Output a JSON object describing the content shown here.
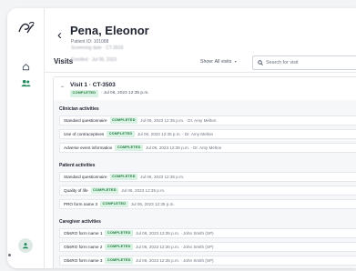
{
  "patient": {
    "name": "Pena, Eleonor",
    "id_line": "Patient ID: 101088",
    "meta_line1": "Screening date · CT-3503",
    "meta_line2": "Enrolled · Jul 06, 2023"
  },
  "visits_header": {
    "title": "Visits",
    "show_label": "Show:",
    "show_value": "All visits",
    "search_placeholder": "Search for visit"
  },
  "visit": {
    "title": "Visit 1 · CT-3503",
    "status": "COMPLETED",
    "date": "· Jul 06, 2023 12:35 p.m."
  },
  "sections": [
    {
      "title": "Clinician activities",
      "rows": [
        {
          "name": "Standard questionnaire",
          "status": "COMPLETED",
          "meta": "Jul 06, 2023 12:35 p.m. · Dr. Amy Melton"
        },
        {
          "name": "Use of contraceptives",
          "status": "COMPLETED",
          "meta": "Jul 06, 2023 12:35 p.m. · Dr. Amy Melton"
        },
        {
          "name": "Adverse event information",
          "status": "COMPLETED",
          "meta": "Jul 06, 2023 12:35 p.m. · Dr. Amy Melton"
        }
      ]
    },
    {
      "title": "Patient activities",
      "rows": [
        {
          "name": "Standard questionnaire",
          "status": "COMPLETED",
          "meta": "Jul 06, 2023 12:35 p.m."
        },
        {
          "name": "Quality of life",
          "status": "COMPLETED",
          "meta": "Jul 06, 2023 12:35 p.m."
        },
        {
          "name": "PRO form name 3",
          "status": "COMPLETED",
          "meta": "Jul 06, 2023 12:35 p.m."
        }
      ]
    },
    {
      "title": "Caregiver activities",
      "rows": [
        {
          "name": "ObsRO form name 1",
          "status": "COMPLETED",
          "meta": "Jul 06, 2023 12:35 p.m. · John Smith (SP)"
        },
        {
          "name": "ObsRO form name 2",
          "status": "COMPLETED",
          "meta": "Jul 06, 2023 12:35 p.m. · John Smith (SP)"
        },
        {
          "name": "ObsRO form name 3",
          "status": "COMPLETED",
          "meta": "Jul 06, 2023 12:35 p.m. · John Smith (SP)"
        }
      ]
    }
  ],
  "icons": {
    "logo": "ds-logo-icon",
    "home": "home-icon",
    "patients": "people-icon",
    "back": "chevron-left-icon",
    "collapse": "chevron-up-icon",
    "search": "search-icon",
    "avatar": "user-icon"
  },
  "colors": {
    "accent_green": "#1b7a3c",
    "badge_bg": "#d9f2e3",
    "patients_icon": "#1f8a5a"
  }
}
